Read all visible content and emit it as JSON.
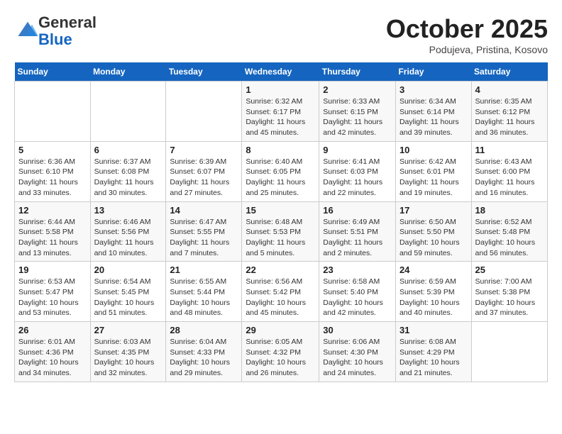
{
  "header": {
    "logo_line1": "General",
    "logo_line2": "Blue",
    "month_title": "October 2025",
    "subtitle": "Podujeva, Pristina, Kosovo"
  },
  "weekdays": [
    "Sunday",
    "Monday",
    "Tuesday",
    "Wednesday",
    "Thursday",
    "Friday",
    "Saturday"
  ],
  "weeks": [
    [
      {
        "day": "",
        "info": ""
      },
      {
        "day": "",
        "info": ""
      },
      {
        "day": "",
        "info": ""
      },
      {
        "day": "1",
        "info": "Sunrise: 6:32 AM\nSunset: 6:17 PM\nDaylight: 11 hours and 45 minutes."
      },
      {
        "day": "2",
        "info": "Sunrise: 6:33 AM\nSunset: 6:15 PM\nDaylight: 11 hours and 42 minutes."
      },
      {
        "day": "3",
        "info": "Sunrise: 6:34 AM\nSunset: 6:14 PM\nDaylight: 11 hours and 39 minutes."
      },
      {
        "day": "4",
        "info": "Sunrise: 6:35 AM\nSunset: 6:12 PM\nDaylight: 11 hours and 36 minutes."
      }
    ],
    [
      {
        "day": "5",
        "info": "Sunrise: 6:36 AM\nSunset: 6:10 PM\nDaylight: 11 hours and 33 minutes."
      },
      {
        "day": "6",
        "info": "Sunrise: 6:37 AM\nSunset: 6:08 PM\nDaylight: 11 hours and 30 minutes."
      },
      {
        "day": "7",
        "info": "Sunrise: 6:39 AM\nSunset: 6:07 PM\nDaylight: 11 hours and 27 minutes."
      },
      {
        "day": "8",
        "info": "Sunrise: 6:40 AM\nSunset: 6:05 PM\nDaylight: 11 hours and 25 minutes."
      },
      {
        "day": "9",
        "info": "Sunrise: 6:41 AM\nSunset: 6:03 PM\nDaylight: 11 hours and 22 minutes."
      },
      {
        "day": "10",
        "info": "Sunrise: 6:42 AM\nSunset: 6:01 PM\nDaylight: 11 hours and 19 minutes."
      },
      {
        "day": "11",
        "info": "Sunrise: 6:43 AM\nSunset: 6:00 PM\nDaylight: 11 hours and 16 minutes."
      }
    ],
    [
      {
        "day": "12",
        "info": "Sunrise: 6:44 AM\nSunset: 5:58 PM\nDaylight: 11 hours and 13 minutes."
      },
      {
        "day": "13",
        "info": "Sunrise: 6:46 AM\nSunset: 5:56 PM\nDaylight: 11 hours and 10 minutes."
      },
      {
        "day": "14",
        "info": "Sunrise: 6:47 AM\nSunset: 5:55 PM\nDaylight: 11 hours and 7 minutes."
      },
      {
        "day": "15",
        "info": "Sunrise: 6:48 AM\nSunset: 5:53 PM\nDaylight: 11 hours and 5 minutes."
      },
      {
        "day": "16",
        "info": "Sunrise: 6:49 AM\nSunset: 5:51 PM\nDaylight: 11 hours and 2 minutes."
      },
      {
        "day": "17",
        "info": "Sunrise: 6:50 AM\nSunset: 5:50 PM\nDaylight: 10 hours and 59 minutes."
      },
      {
        "day": "18",
        "info": "Sunrise: 6:52 AM\nSunset: 5:48 PM\nDaylight: 10 hours and 56 minutes."
      }
    ],
    [
      {
        "day": "19",
        "info": "Sunrise: 6:53 AM\nSunset: 5:47 PM\nDaylight: 10 hours and 53 minutes."
      },
      {
        "day": "20",
        "info": "Sunrise: 6:54 AM\nSunset: 5:45 PM\nDaylight: 10 hours and 51 minutes."
      },
      {
        "day": "21",
        "info": "Sunrise: 6:55 AM\nSunset: 5:44 PM\nDaylight: 10 hours and 48 minutes."
      },
      {
        "day": "22",
        "info": "Sunrise: 6:56 AM\nSunset: 5:42 PM\nDaylight: 10 hours and 45 minutes."
      },
      {
        "day": "23",
        "info": "Sunrise: 6:58 AM\nSunset: 5:40 PM\nDaylight: 10 hours and 42 minutes."
      },
      {
        "day": "24",
        "info": "Sunrise: 6:59 AM\nSunset: 5:39 PM\nDaylight: 10 hours and 40 minutes."
      },
      {
        "day": "25",
        "info": "Sunrise: 7:00 AM\nSunset: 5:38 PM\nDaylight: 10 hours and 37 minutes."
      }
    ],
    [
      {
        "day": "26",
        "info": "Sunrise: 6:01 AM\nSunset: 4:36 PM\nDaylight: 10 hours and 34 minutes."
      },
      {
        "day": "27",
        "info": "Sunrise: 6:03 AM\nSunset: 4:35 PM\nDaylight: 10 hours and 32 minutes."
      },
      {
        "day": "28",
        "info": "Sunrise: 6:04 AM\nSunset: 4:33 PM\nDaylight: 10 hours and 29 minutes."
      },
      {
        "day": "29",
        "info": "Sunrise: 6:05 AM\nSunset: 4:32 PM\nDaylight: 10 hours and 26 minutes."
      },
      {
        "day": "30",
        "info": "Sunrise: 6:06 AM\nSunset: 4:30 PM\nDaylight: 10 hours and 24 minutes."
      },
      {
        "day": "31",
        "info": "Sunrise: 6:08 AM\nSunset: 4:29 PM\nDaylight: 10 hours and 21 minutes."
      },
      {
        "day": "",
        "info": ""
      }
    ]
  ]
}
